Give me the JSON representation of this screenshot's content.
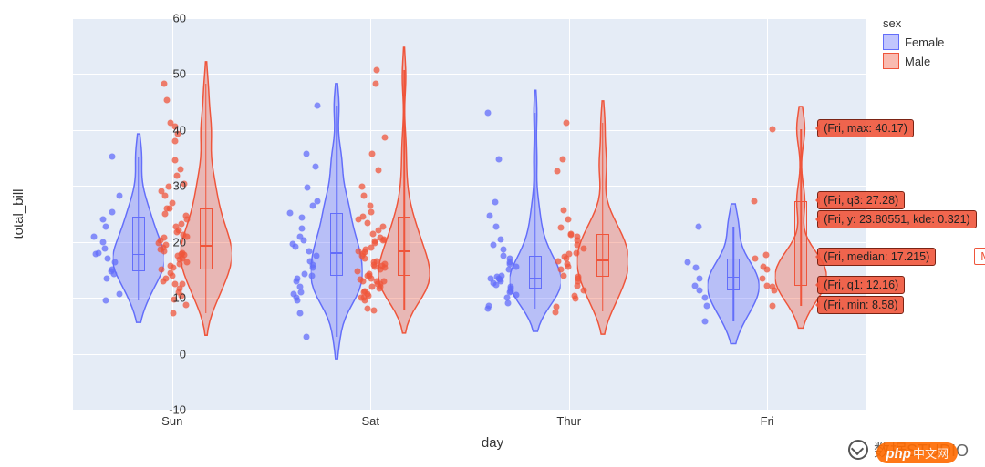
{
  "chart_data": {
    "type": "violin+box+strip",
    "xlabel": "day",
    "ylabel": "total_bill",
    "ylim": [
      -10,
      60
    ],
    "x_categories": [
      "Sun",
      "Sat",
      "Thur",
      "Fri"
    ],
    "legend": {
      "title": "sex",
      "items": [
        "Female",
        "Male"
      ]
    },
    "colors": {
      "Female": "#636efa",
      "Male": "#ef553b"
    },
    "series": [
      {
        "name": "Female",
        "box_stats": {
          "Sun": {
            "min": 9.6,
            "q1": 14.8,
            "median": 18.0,
            "q3": 24.5,
            "max": 35.3
          },
          "Sat": {
            "min": 3.1,
            "q1": 14.0,
            "median": 18.3,
            "q3": 25.1,
            "max": 44.3
          },
          "Thur": {
            "min": 8.0,
            "q1": 11.7,
            "median": 13.8,
            "q3": 17.5,
            "max": 43.1
          },
          "Fri": {
            "min": 5.8,
            "q1": 11.3,
            "median": 14.0,
            "q3": 17.0,
            "max": 22.8
          }
        },
        "points": {
          "Sun": [
            9.6,
            10.6,
            13.4,
            14.3,
            14.8,
            15.0,
            16.3,
            17.0,
            17.9,
            18.0,
            18.8,
            20.0,
            20.9,
            22.8,
            24.0,
            25.3,
            28.2,
            35.3
          ],
          "Sat": [
            3.1,
            7.3,
            9.6,
            10.1,
            10.6,
            11.0,
            12.0,
            13.0,
            13.4,
            14.0,
            14.3,
            15.4,
            15.9,
            16.5,
            17.5,
            18.3,
            19.1,
            19.7,
            20.3,
            21.0,
            22.4,
            24.3,
            25.2,
            26.4,
            27.3,
            29.8,
            33.4,
            35.8,
            44.3
          ],
          "Thur": [
            8.0,
            8.5,
            9.0,
            10.1,
            10.5,
            11.0,
            11.2,
            11.7,
            12.0,
            12.3,
            12.7,
            13.0,
            13.3,
            13.4,
            13.5,
            13.8,
            14.0,
            15.0,
            15.5,
            16.0,
            16.4,
            17.0,
            17.5,
            18.6,
            19.4,
            20.5,
            22.8,
            24.6,
            27.1,
            34.8,
            43.1
          ],
          "Fri": [
            5.8,
            8.6,
            10.1,
            11.4,
            12.2,
            13.4,
            15.4,
            16.3,
            22.8
          ]
        }
      },
      {
        "name": "Male",
        "box_stats": {
          "Sun": {
            "min": 7.3,
            "q1": 15.0,
            "median": 19.6,
            "q3": 26.0,
            "max": 48.2
          },
          "Sat": {
            "min": 7.7,
            "q1": 14.0,
            "median": 18.6,
            "q3": 24.5,
            "max": 50.8
          },
          "Thur": {
            "min": 7.5,
            "q1": 13.8,
            "median": 17.0,
            "q3": 21.5,
            "max": 41.2
          },
          "Fri": {
            "min": 8.58,
            "q1": 12.16,
            "median": 17.215,
            "q3": 27.28,
            "max": 40.17
          }
        },
        "points": {
          "Sun": [
            7.3,
            8.8,
            9.7,
            10.3,
            11.0,
            11.7,
            12.5,
            12.5,
            13.0,
            13.4,
            14.0,
            14.5,
            15.0,
            15.4,
            15.7,
            16.0,
            16.3,
            16.8,
            17.0,
            17.5,
            17.6,
            17.9,
            18.0,
            18.3,
            18.7,
            19.0,
            19.4,
            19.8,
            20.3,
            20.7,
            21.0,
            21.2,
            21.7,
            22.0,
            22.8,
            23.2,
            24.0,
            24.6,
            25.0,
            25.9,
            26.0,
            26.9,
            28.2,
            29.0,
            29.9,
            30.4,
            31.9,
            32.9,
            34.6,
            38.1,
            39.4,
            40.6,
            41.2,
            45.4,
            48.2
          ],
          "Sat": [
            7.7,
            8.0,
            9.6,
            10.0,
            10.1,
            10.3,
            10.6,
            11.0,
            11.2,
            11.6,
            12.0,
            12.0,
            12.5,
            12.5,
            12.9,
            13.0,
            13.0,
            13.3,
            13.5,
            13.9,
            14.0,
            14.3,
            14.7,
            15.0,
            15.4,
            15.5,
            15.7,
            15.9,
            16.0,
            16.3,
            16.5,
            17.0,
            17.5,
            17.8,
            18.2,
            18.4,
            18.6,
            19.0,
            19.8,
            20.1,
            20.3,
            20.5,
            20.8,
            21.5,
            22.1,
            22.8,
            23.3,
            24.1,
            24.5,
            25.3,
            26.4,
            28.2,
            29.9,
            32.8,
            35.8,
            38.7,
            48.3,
            50.8
          ],
          "Thur": [
            7.5,
            8.4,
            9.8,
            10.3,
            11.3,
            12.2,
            13.0,
            13.4,
            13.8,
            14.0,
            15.0,
            15.5,
            16.0,
            16.5,
            17.0,
            17.3,
            17.9,
            18.0,
            18.8,
            19.4,
            20.3,
            21.0,
            21.2,
            21.5,
            22.5,
            24.1,
            25.6,
            32.7,
            34.8,
            41.2
          ],
          "Fri": [
            8.58,
            11.4,
            12.0,
            12.2,
            13.4,
            15.0,
            15.6,
            17.0,
            17.6,
            27.3,
            40.2
          ]
        }
      }
    ],
    "hover": {
      "series": "Male",
      "category": "Fri",
      "labels": [
        "(Fri, max: 40.17)",
        "(Fri, q3: 27.28)",
        "(Fri, y: 23.80551, kde: 0.321)",
        "(Fri, median: 17.215)",
        "(Fri, q1: 12.16)",
        "(Fri, min: 8.58)"
      ]
    },
    "yticks": [
      -10,
      0,
      10,
      20,
      30,
      40,
      50,
      60
    ]
  },
  "watermark": {
    "text": "数据STUDIO",
    "php": "php",
    "php_cn": "中文网"
  }
}
